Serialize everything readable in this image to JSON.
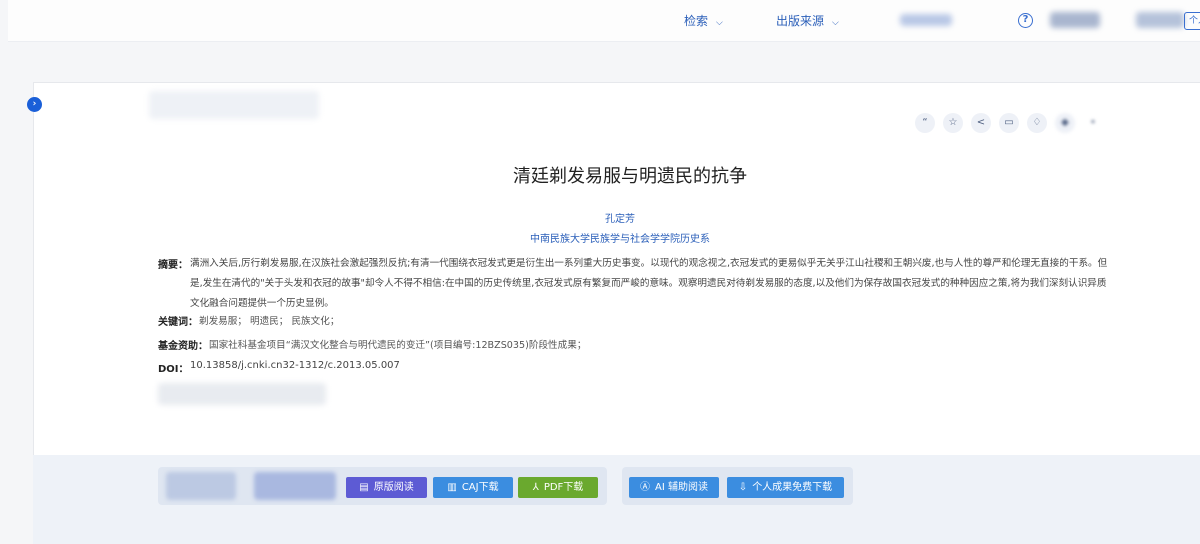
{
  "topbar": {
    "search_label": "检索",
    "source_label": "出版来源",
    "help_icon": "?",
    "user_label": "个人"
  },
  "colors": {
    "accent": "#2b5fb9",
    "purple_button": "#5d5bd4",
    "blue_button": "#3b8de0",
    "green_button": "#6aa92e"
  },
  "toolbar": {
    "icons": [
      "quote-icon",
      "star-icon",
      "share-icon",
      "print-icon",
      "bell-icon",
      "more-icon",
      "translate-icon"
    ]
  },
  "article": {
    "title": "清廷剃发易服与明遗民的抗争",
    "author": "孔定芳",
    "organization": "中南民族大学民族学与社会学学院历史系",
    "abstract_label": "摘要：",
    "abstract": "满洲入关后,厉行剃发易服,在汉族社会激起强烈反抗;有清一代围绕衣冠发式更是衍生出一系列重大历史事变。以现代的观念视之,衣冠发式的更易似乎无关乎江山社稷和王朝兴废,也与人性的尊严和伦理无直接的干系。但是,发生在清代的\"关于头发和衣冠的故事\"却令人不得不相信:在中国的历史传统里,衣冠发式原有繁复而严峻的意味。观察明遗民对待剃发易服的态度,以及他们为保存故国衣冠发式的种种因应之策,将为我们深刻认识异质文化融合问题提供一个历史显例。",
    "keywords_label": "关键词：",
    "keywords": "剃发易服；  明遗民；  民族文化；",
    "fund_label": "基金资助：",
    "fund": "国家社科基金项目“满汉文化整合与明代遗民的变迁”(项目编号:12BZS035)阶段性成果；",
    "doi_label": "DOI：",
    "doi": "10.13858/j.cnki.cn32-1312/c.2013.05.007"
  },
  "actions": {
    "original_read": "原版阅读",
    "caj_download": "CAJ下载",
    "pdf_download": "PDF下载",
    "ai_read": "AI 辅助阅读",
    "personal_download": "个人成果免费下载"
  }
}
